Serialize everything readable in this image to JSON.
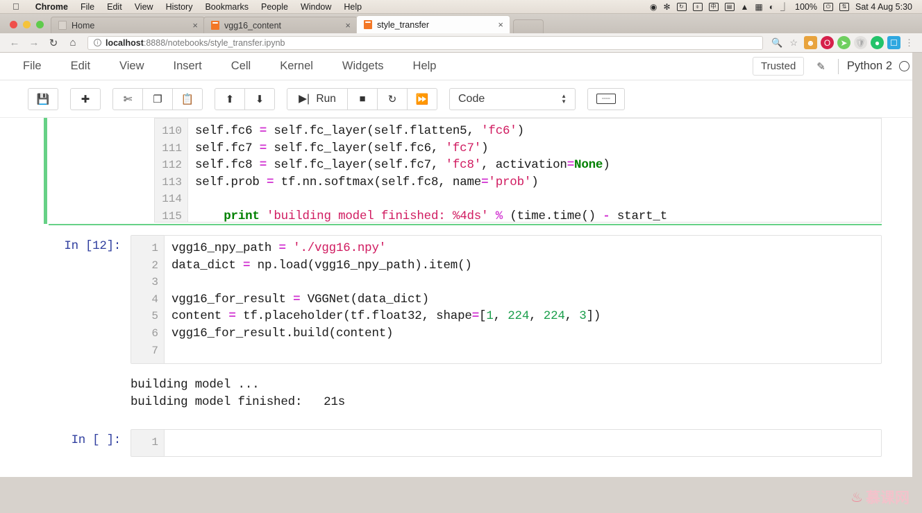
{
  "os_menubar": {
    "apple_icon": "apple-logo",
    "items": [
      {
        "label": "Chrome",
        "bold": true
      },
      {
        "label": "File",
        "bold": false
      },
      {
        "label": "Edit",
        "bold": false
      },
      {
        "label": "View",
        "bold": false
      },
      {
        "label": "History",
        "bold": false
      },
      {
        "label": "Bookmarks",
        "bold": false
      },
      {
        "label": "People",
        "bold": false
      },
      {
        "label": "Window",
        "bold": false
      },
      {
        "label": "Help",
        "bold": false
      }
    ],
    "status_icons": [
      "record-icon",
      "bluetooth-icon",
      "sync-icon",
      "usb-icon",
      "input-source-chinese-icon",
      "screen-icon",
      "dropbox-icon",
      "battery-icon",
      "wifi-icon",
      "airplay-icon"
    ],
    "battery_percent": "100%",
    "clock": "Sat 4 Aug  5:30"
  },
  "browser": {
    "tabs": [
      {
        "title": "Home",
        "favicon": "book-icon",
        "active": false
      },
      {
        "title": "vgg16_content",
        "favicon": "jupyter-icon",
        "active": false
      },
      {
        "title": "style_transfer",
        "favicon": "jupyter-icon",
        "active": true
      }
    ],
    "close_glyph": "×",
    "nav": {
      "back": "back-arrow-icon",
      "forward": "forward-arrow-icon",
      "reload": "reload-icon",
      "home": "home-icon"
    },
    "url": {
      "info_glyph": "ⓘ",
      "host": "localhost",
      "rest": ":8888/notebooks/style_transfer.ipynb",
      "full": "localhost:8888/notebooks/style_transfer.ipynb"
    },
    "omnibox_icons": [
      "zoom-icon",
      "bookmark-star-icon"
    ],
    "extensions": [
      {
        "name": "extension-evernote-icon",
        "color": "#e8a33d"
      },
      {
        "name": "extension-opera-icon",
        "color": "#d6204a"
      },
      {
        "name": "extension-pocket-icon",
        "color": "#6fcf5f"
      },
      {
        "name": "extension-shield-icon",
        "color": "#cfcfcf"
      },
      {
        "name": "extension-chat-icon",
        "color": "#23c36a"
      },
      {
        "name": "extension-screenshot-icon",
        "color": "#2fa8e0"
      }
    ],
    "menu_glyph": "⋮"
  },
  "jupyter": {
    "menu": [
      "File",
      "Edit",
      "View",
      "Insert",
      "Cell",
      "Kernel",
      "Widgets",
      "Help"
    ],
    "trusted_label": "Trusted",
    "edit_icon": "pencil-icon",
    "kernel_name": "Python 2",
    "kernel_status": "kernel-idle-circle",
    "toolbar": {
      "save": "💾",
      "save_name": "save-icon",
      "insert": "✚",
      "cut": "✂",
      "copy": "copy-icon",
      "paste": "paste-icon",
      "move_up": "⬆",
      "move_down": "⬇",
      "run_label": "Run",
      "run_glyph": "▶|",
      "stop": "■",
      "restart": "↻",
      "restart_run_all": "⏩",
      "cell_type": "Code",
      "keyboard": "keyboard-icon"
    }
  },
  "notebook": {
    "top_cell": {
      "selected": true,
      "line_start": 110,
      "lines": [
        {
          "n": "110",
          "text": "self.fc6 = self.fc_layer(self.flatten5, 'fc6')"
        },
        {
          "n": "111",
          "text": "self.fc7 = self.fc_layer(self.fc6, 'fc7')"
        },
        {
          "n": "112",
          "text": "self.fc8 = self.fc_layer(self.fc7, 'fc8', activation=None)"
        },
        {
          "n": "113",
          "text": "self.prob = tf.nn.softmax(self.fc8, name='prob')"
        },
        {
          "n": "114",
          "text": ""
        },
        {
          "n": "115",
          "text": "    print 'building model finished: %4ds' % (time.time() - start_t"
        }
      ]
    },
    "main_cell": {
      "prompt": "In [12]:",
      "lines": [
        {
          "n": "1",
          "text": "vgg16_npy_path = './vgg16.npy'"
        },
        {
          "n": "2",
          "text": "data_dict = np.load(vgg16_npy_path).item()"
        },
        {
          "n": "3",
          "text": ""
        },
        {
          "n": "4",
          "text": "vgg16_for_result = VGGNet(data_dict)"
        },
        {
          "n": "5",
          "text": "content = tf.placeholder(tf.float32, shape=[1, 224, 224, 3])"
        },
        {
          "n": "6",
          "text": "vgg16_for_result.build(content)"
        },
        {
          "n": "7",
          "text": ""
        }
      ],
      "output": [
        "building model ...",
        "building model finished:   21s"
      ]
    },
    "empty_cell": {
      "prompt": "In [ ]:",
      "lines": [
        {
          "n": "1",
          "text": ""
        }
      ]
    }
  },
  "watermark": {
    "icon": "flame-icon",
    "text": "慕课网"
  },
  "colors": {
    "selected_cell_accent": "#66d186",
    "jupyter_orange": "#f37726",
    "prompt_blue": "#303f9f",
    "string_red": "#d01b60",
    "operator_magenta": "#d33bd3",
    "keyword_green": "#008000",
    "number_green": "#1a9e4b"
  }
}
